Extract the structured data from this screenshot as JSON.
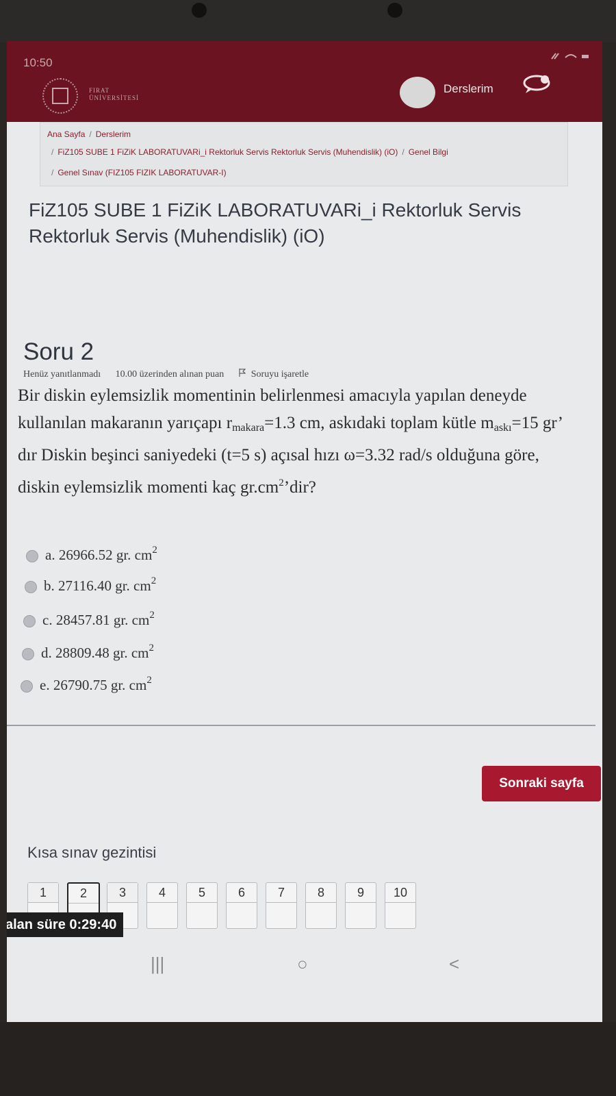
{
  "status_bar": {
    "time": "10:50"
  },
  "header": {
    "logo_text_line1": "FIRAT",
    "logo_text_line2": "ÜNİVERSİTESİ",
    "derslerim_label": "Derslerim"
  },
  "breadcrumb": {
    "items": [
      "Ana Sayfa",
      "Derslerim",
      "FiZ105 SUBE 1 FiZiK LABORATUVARi_i Rektorluk Servis Rektorluk Servis (Muhendislik) (iO)",
      "Genel Bilgi",
      "Genel Sınav (FIZ105 FIZIK LABORATUVAR-I)"
    ],
    "separator": "/"
  },
  "course": {
    "title": "FiZ105 SUBE 1 FiZiK LABORATUVARi_i Rektorluk Servis Rektorluk Servis (Muhendislik) (iO)"
  },
  "question": {
    "title": "Soru 2",
    "status": "Henüz yanıtlanmadı",
    "points": "10.00 üzerinden alınan puan",
    "flag_label": "Soruyu işaretle",
    "text": {
      "p1": "Bir diskin eylemsizlik momentinin belirlenmesi amacıyla yapılan deneyde kullanılan makaranın yarıçapı r",
      "r_sub": "makara",
      "p2": "=1.3 cm, askıdaki toplam kütle m",
      "m_sub": "askı",
      "p3": "=15 gr’ dır Diskin beşinci saniyedeki (t=5 s) açısal hızı ω=3.32 rad/s olduğuna göre, diskin eylemsizlik momenti kaç gr.cm",
      "sup": "2",
      "p4": "’dir?"
    },
    "answers": [
      {
        "letter": "a.",
        "value": "26966.52 gr. cm",
        "unit_sup": "2"
      },
      {
        "letter": "b.",
        "value": "27116.40 gr. cm",
        "unit_sup": "2"
      },
      {
        "letter": "c.",
        "value": "28457.81 gr. cm",
        "unit_sup": "2"
      },
      {
        "letter": "d.",
        "value": "28809.48 gr. cm",
        "unit_sup": "2"
      },
      {
        "letter": "e.",
        "value": "26790.75 gr. cm",
        "unit_sup": "2"
      }
    ]
  },
  "next_button_label": "Sonraki sayfa",
  "quiz_nav": {
    "title": "Kısa sınav gezintisi",
    "numbers": [
      "1",
      "2",
      "3",
      "4",
      "5",
      "6",
      "7",
      "8",
      "9",
      "10"
    ],
    "current": "2"
  },
  "timer": {
    "label": "alan süre ",
    "value": "0:29:40"
  },
  "system_nav": {
    "recents": "|||",
    "home": "○",
    "back": "<"
  }
}
